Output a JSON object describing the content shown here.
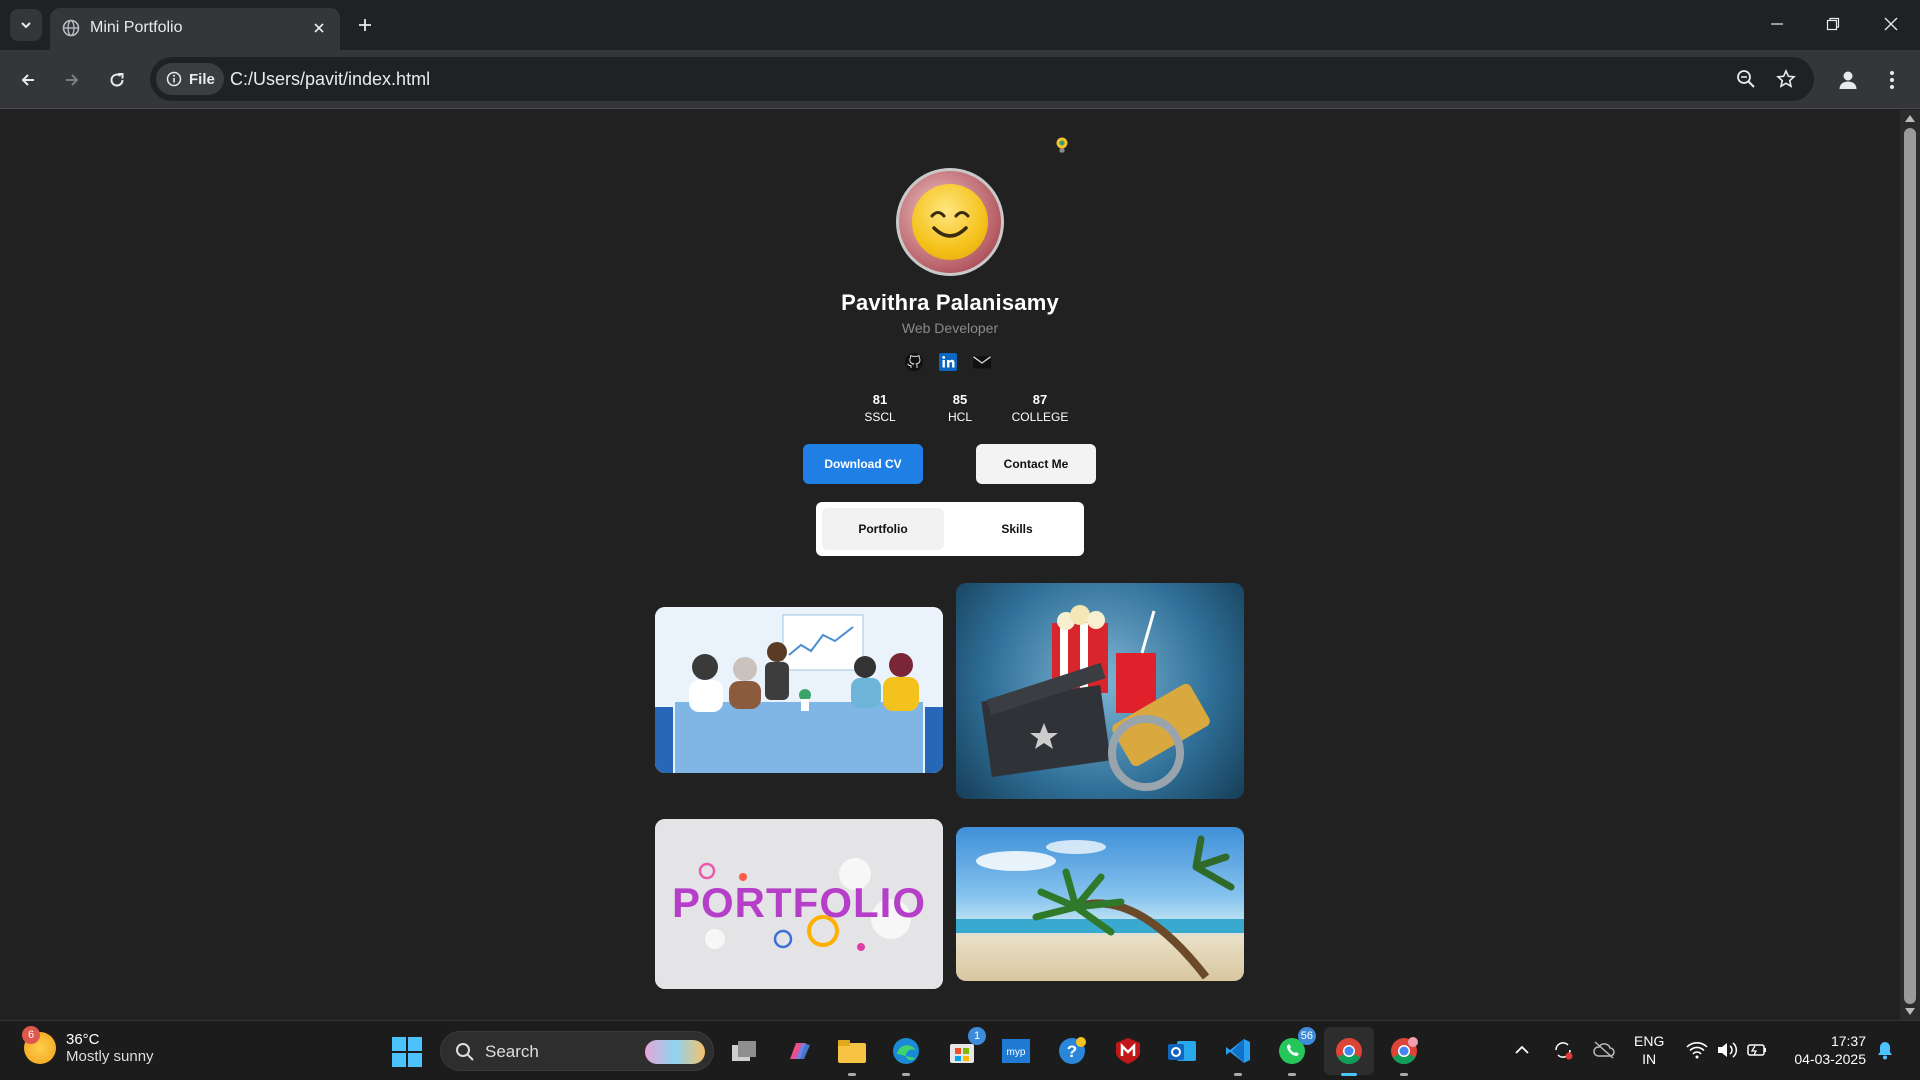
{
  "browser": {
    "tab_title": "Mini Portfolio",
    "chip_label": "File",
    "url": "C:/Users/pavit/index.html"
  },
  "profile": {
    "name": "Pavithra Palanisamy",
    "role": "Web Developer",
    "stats": [
      {
        "value": "81",
        "label": "SSCL"
      },
      {
        "value": "85",
        "label": "HCL"
      },
      {
        "value": "87",
        "label": "COLLEGE"
      }
    ],
    "download_label": "Download CV",
    "contact_label": "Contact Me",
    "tabs": [
      "Portfolio",
      "Skills"
    ],
    "active_tab": "Portfolio",
    "portfolio_art_text": "PORTFOLIO"
  },
  "taskbar": {
    "weather_temp": "36°C",
    "weather_desc": "Mostly sunny",
    "weather_badge": "6",
    "search_label": "Search",
    "store_badge": "1",
    "whatsapp_badge": "56",
    "lang_line1": "ENG",
    "lang_line2": "IN",
    "time": "17:37",
    "date": "04-03-2025"
  },
  "colors": {
    "page_bg": "#212121",
    "primary_button": "#1f7fe5",
    "chrome_bg": "#202124"
  }
}
